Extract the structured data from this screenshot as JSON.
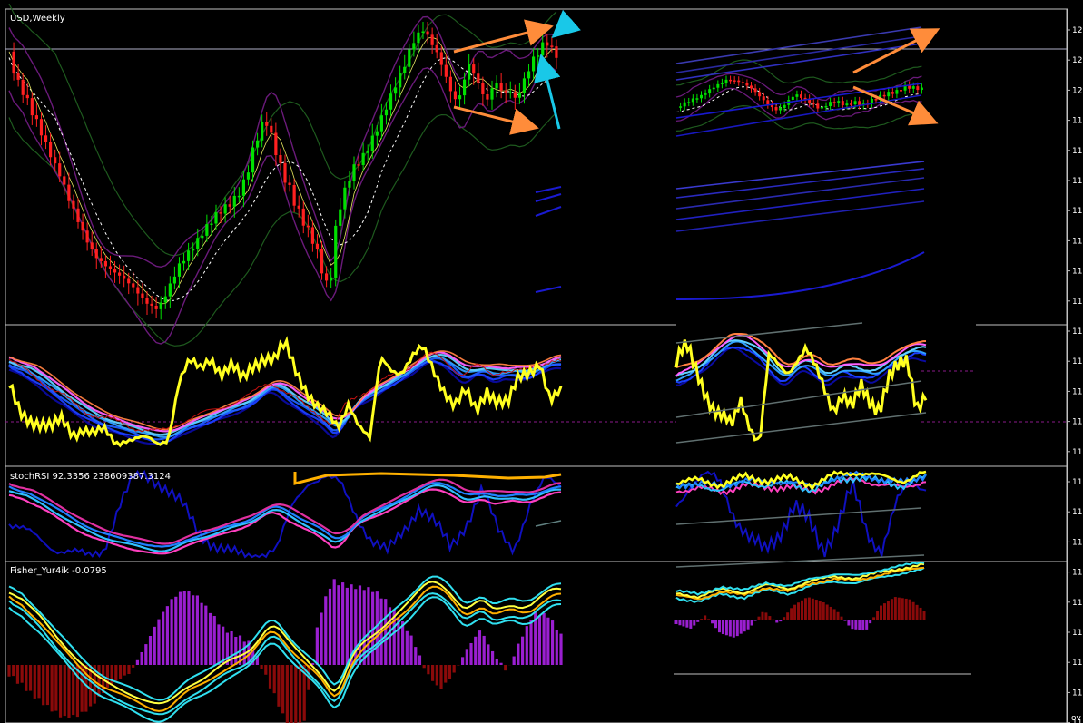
{
  "window": {
    "chart_title": "USD,Weekly",
    "stochrsi_label": "stochRSI 92.3356 238609387.3124",
    "fisher_label": "Fisher_Yur4ik -0.0795",
    "corner_label": "ov"
  },
  "colors": {
    "background": "#000000",
    "frame": "#c0c0c0",
    "bull": "#00e000",
    "bear": "#ff2020",
    "bands": "#1e5a1e",
    "envelope": "#6a1a7a",
    "trend_arrow": "#ff8c3a",
    "cyan_arrow": "#19c8e8",
    "yellow": "#ffff20",
    "blue": "#1a1ad0",
    "cyan": "#30e0f0",
    "magenta": "#e030c0",
    "purple_hist": "#9a1fd0",
    "red_hist": "#8a0a0a"
  },
  "price_axis": {
    "ticks": [
      "12",
      "12",
      "12",
      "11",
      "11",
      "11",
      "11",
      "11",
      "11",
      "11",
      "11",
      "11",
      "11",
      "11",
      "11",
      "11",
      "11",
      "11",
      "11",
      "11",
      "11",
      "11",
      "11",
      "11",
      "10"
    ]
  },
  "chart_data": [
    {
      "type": "candlestick",
      "title": "USD,Weekly",
      "values": [
        0.88,
        0.82,
        0.78,
        0.75,
        0.7,
        0.66,
        0.6,
        0.55,
        0.5,
        0.46,
        0.4,
        0.36,
        0.32,
        0.28,
        0.25,
        0.22,
        0.2,
        0.18,
        0.16,
        0.14,
        0.12,
        0.1,
        0.08,
        0.06,
        0.05,
        0.04,
        0.06,
        0.1,
        0.14,
        0.18,
        0.2,
        0.22,
        0.24,
        0.27,
        0.3,
        0.33,
        0.36,
        0.38,
        0.4,
        0.42,
        0.45,
        0.5,
        0.57,
        0.62,
        0.66,
        0.6,
        0.54,
        0.48,
        0.45,
        0.4,
        0.36,
        0.32,
        0.28,
        0.22,
        0.14,
        0.08,
        0.28,
        0.38,
        0.44,
        0.5,
        0.53,
        0.56,
        0.6,
        0.64,
        0.68,
        0.72,
        0.76,
        0.8,
        0.84,
        0.9,
        0.94,
        0.97,
        0.95,
        0.92,
        0.88,
        0.82,
        0.76,
        0.72,
        0.78,
        0.84,
        0.8,
        0.76,
        0.72,
        0.78,
        0.8,
        0.76,
        0.78,
        0.74,
        0.78,
        0.82,
        0.86,
        0.88,
        0.92,
        0.9,
        0.88
      ]
    },
    {
      "type": "line",
      "title": "",
      "values": [
        0.55,
        0.35,
        0.3,
        0.25,
        0.2,
        0.28,
        0.18,
        0.22,
        0.15,
        0.18,
        0.1,
        0.14,
        0.12,
        0.1,
        0.08,
        0.15,
        0.6,
        0.75,
        0.7,
        0.82,
        0.68,
        0.72,
        0.6,
        0.75,
        0.82,
        0.78,
        0.9,
        0.7,
        0.55,
        0.4,
        0.3,
        0.2,
        0.45,
        0.25,
        0.1,
        0.78,
        0.72,
        0.7,
        0.8,
        0.86,
        0.7,
        0.55,
        0.4,
        0.5,
        0.35,
        0.55,
        0.45,
        0.4,
        0.62,
        0.7,
        0.78,
        0.42,
        0.5
      ]
    },
    {
      "type": "line",
      "title": "stochRSI 92.3356 238609387.3124",
      "values": [
        0.4,
        0.3,
        0.2,
        0.1,
        0.05,
        0.0,
        0.1,
        0.6,
        0.95,
        0.95,
        0.8,
        0.6,
        0.3,
        0.15,
        0.05,
        0.0,
        0.05,
        0.1,
        0.6,
        0.9,
        0.95,
        0.85,
        0.5,
        0.2,
        0.05,
        0.3,
        0.6,
        0.4,
        0.1,
        0.4,
        0.8,
        0.3,
        0.1,
        0.6,
        0.9,
        0.85
      ]
    },
    {
      "type": "bar",
      "title": "Fisher_Yur4ik -0.0795",
      "values": [
        -0.1,
        -0.2,
        -0.35,
        -0.5,
        -0.6,
        -0.55,
        -0.45,
        -0.3,
        -0.2,
        -0.1,
        0.2,
        0.5,
        0.7,
        0.8,
        0.75,
        0.6,
        0.4,
        0.3,
        0.2,
        -0.1,
        -0.4,
        -0.8,
        -0.6,
        0.5,
        0.95,
        0.9,
        0.85,
        0.8,
        0.7,
        0.55,
        0.3,
        -0.1,
        -0.3,
        -0.1,
        0.2,
        0.4,
        0.1,
        -0.1,
        0.3,
        0.6,
        0.55,
        0.3
      ]
    }
  ]
}
